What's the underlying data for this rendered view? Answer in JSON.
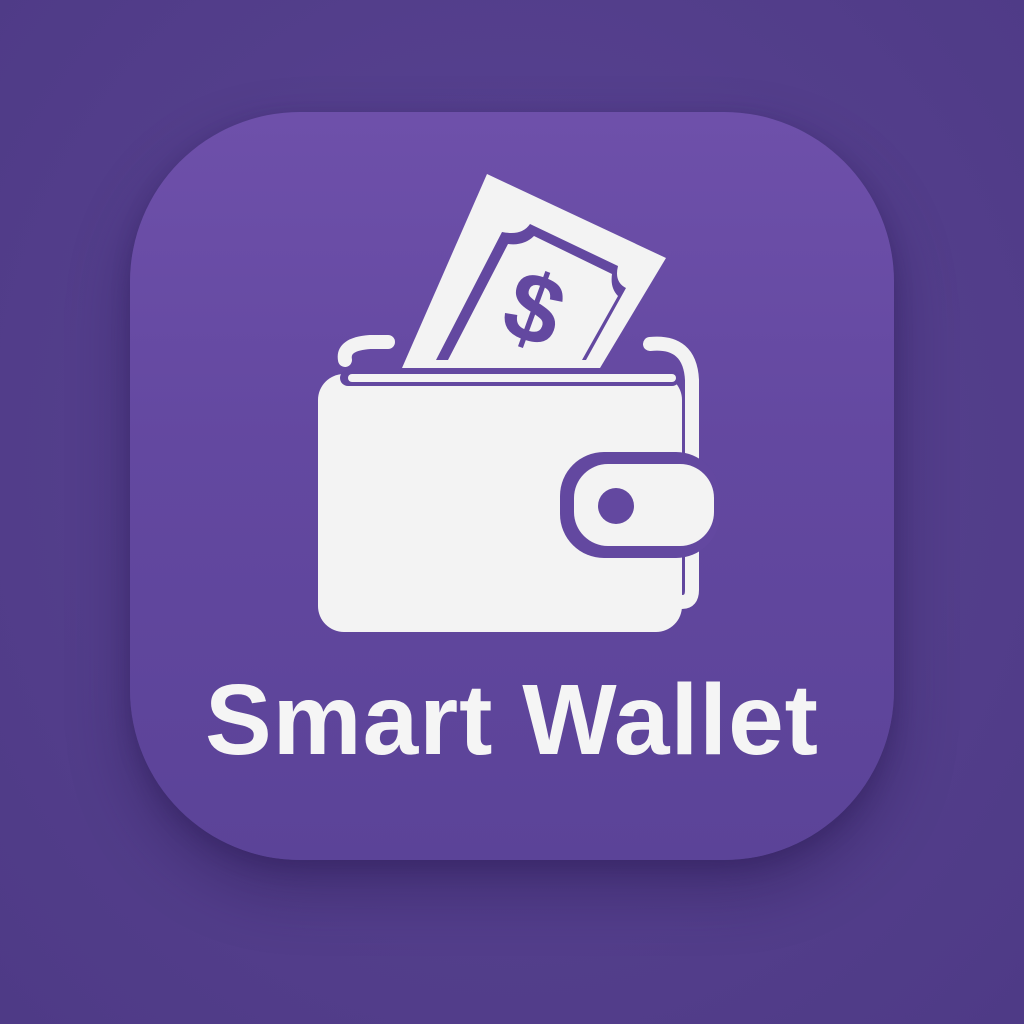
{
  "app": {
    "name": "Smart Wallet"
  },
  "icon": {
    "name": "wallet-with-cash-icon",
    "currency_symbol": "$"
  },
  "colors": {
    "background": "#55408d",
    "tile_top": "#6e50aa",
    "tile_bottom": "#5b4398",
    "glyph": "#f3f3f3"
  }
}
